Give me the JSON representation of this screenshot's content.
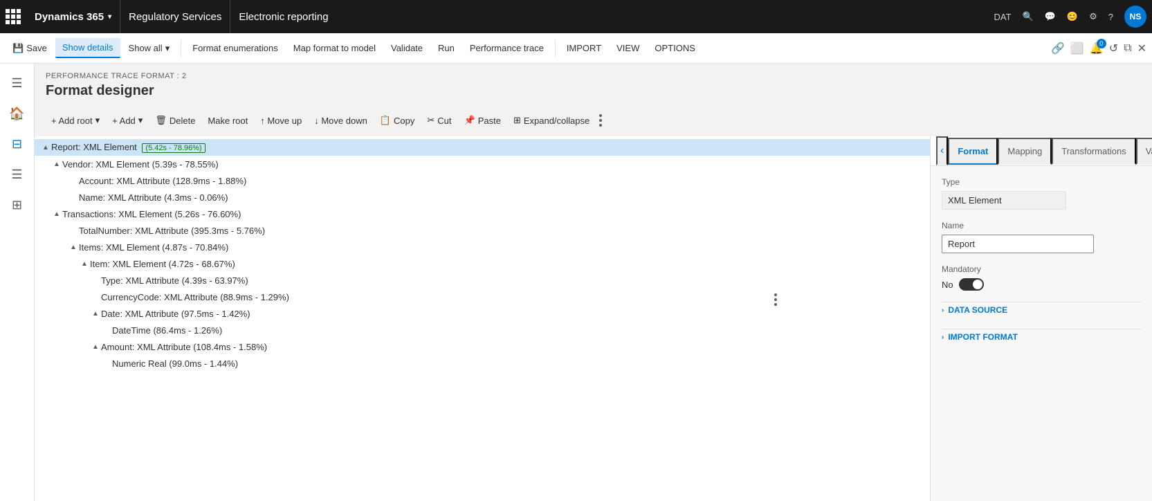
{
  "topnav": {
    "app_title": "Dynamics 365",
    "app_chevron": "▾",
    "regulatory": "Regulatory Services",
    "module": "Electronic reporting",
    "env": "DAT",
    "avatar_initials": "NS"
  },
  "ribbon": {
    "save": "Save",
    "show_details": "Show details",
    "show_all": "Show all",
    "show_all_chevron": "▾",
    "format_enumerations": "Format enumerations",
    "map_format_to_model": "Map format to model",
    "validate": "Validate",
    "run": "Run",
    "performance_trace": "Performance trace",
    "import": "IMPORT",
    "view": "VIEW",
    "options": "OPTIONS"
  },
  "page": {
    "breadcrumb": "PERFORMANCE TRACE FORMAT : 2",
    "title": "Format designer"
  },
  "toolbar": {
    "add_root": "+ Add root",
    "add": "+ Add",
    "delete": "Delete",
    "make_root": "Make root",
    "move_up": "↑ Move up",
    "move_down": "↓ Move down",
    "copy": "Copy",
    "cut": "Cut",
    "paste": "Paste",
    "expand_collapse": "Expand/collapse"
  },
  "right_panel": {
    "tabs": [
      "Format",
      "Mapping",
      "Transformations",
      "Validations"
    ],
    "active_tab": "Format",
    "type_label": "Type",
    "type_value": "XML Element",
    "name_label": "Name",
    "name_value": "Report",
    "mandatory_label": "Mandatory",
    "mandatory_no": "No",
    "data_source_section": "DATA SOURCE",
    "import_format_section": "IMPORT FORMAT"
  },
  "tree": [
    {
      "id": 0,
      "level": 0,
      "expand": "▲",
      "text": "Report: XML Element",
      "perf": "(5.42s - 78.96%)",
      "selected": true
    },
    {
      "id": 1,
      "level": 1,
      "expand": "▲",
      "text": "Vendor: XML Element (5.39s - 78.55%)",
      "perf": ""
    },
    {
      "id": 2,
      "level": 2,
      "expand": "",
      "text": "Account: XML Attribute (128.9ms - 1.88%)",
      "perf": ""
    },
    {
      "id": 3,
      "level": 2,
      "expand": "",
      "text": "Name: XML Attribute (4.3ms - 0.06%)",
      "perf": ""
    },
    {
      "id": 4,
      "level": 1,
      "expand": "▲",
      "text": "Transactions: XML Element (5.26s - 76.60%)",
      "perf": ""
    },
    {
      "id": 5,
      "level": 2,
      "expand": "",
      "text": "TotalNumber: XML Attribute (395.3ms - 5.76%)",
      "perf": ""
    },
    {
      "id": 6,
      "level": 2,
      "expand": "▲",
      "text": "Items: XML Element (4.87s - 70.84%)",
      "perf": ""
    },
    {
      "id": 7,
      "level": 3,
      "expand": "▲",
      "text": "Item: XML Element (4.72s - 68.67%)",
      "perf": ""
    },
    {
      "id": 8,
      "level": 4,
      "expand": "",
      "text": "Type: XML Attribute (4.39s - 63.97%)",
      "perf": ""
    },
    {
      "id": 9,
      "level": 4,
      "expand": "",
      "text": "CurrencyCode: XML Attribute (88.9ms - 1.29%)",
      "perf": ""
    },
    {
      "id": 10,
      "level": 4,
      "expand": "▲",
      "text": "Date: XML Attribute (97.5ms - 1.42%)",
      "perf": ""
    },
    {
      "id": 11,
      "level": 5,
      "expand": "",
      "text": "DateTime (86.4ms - 1.26%)",
      "perf": ""
    },
    {
      "id": 12,
      "level": 4,
      "expand": "▲",
      "text": "Amount: XML Attribute (108.4ms - 1.58%)",
      "perf": ""
    },
    {
      "id": 13,
      "level": 5,
      "expand": "",
      "text": "Numeric Real (99.0ms - 1.44%)",
      "perf": ""
    }
  ]
}
